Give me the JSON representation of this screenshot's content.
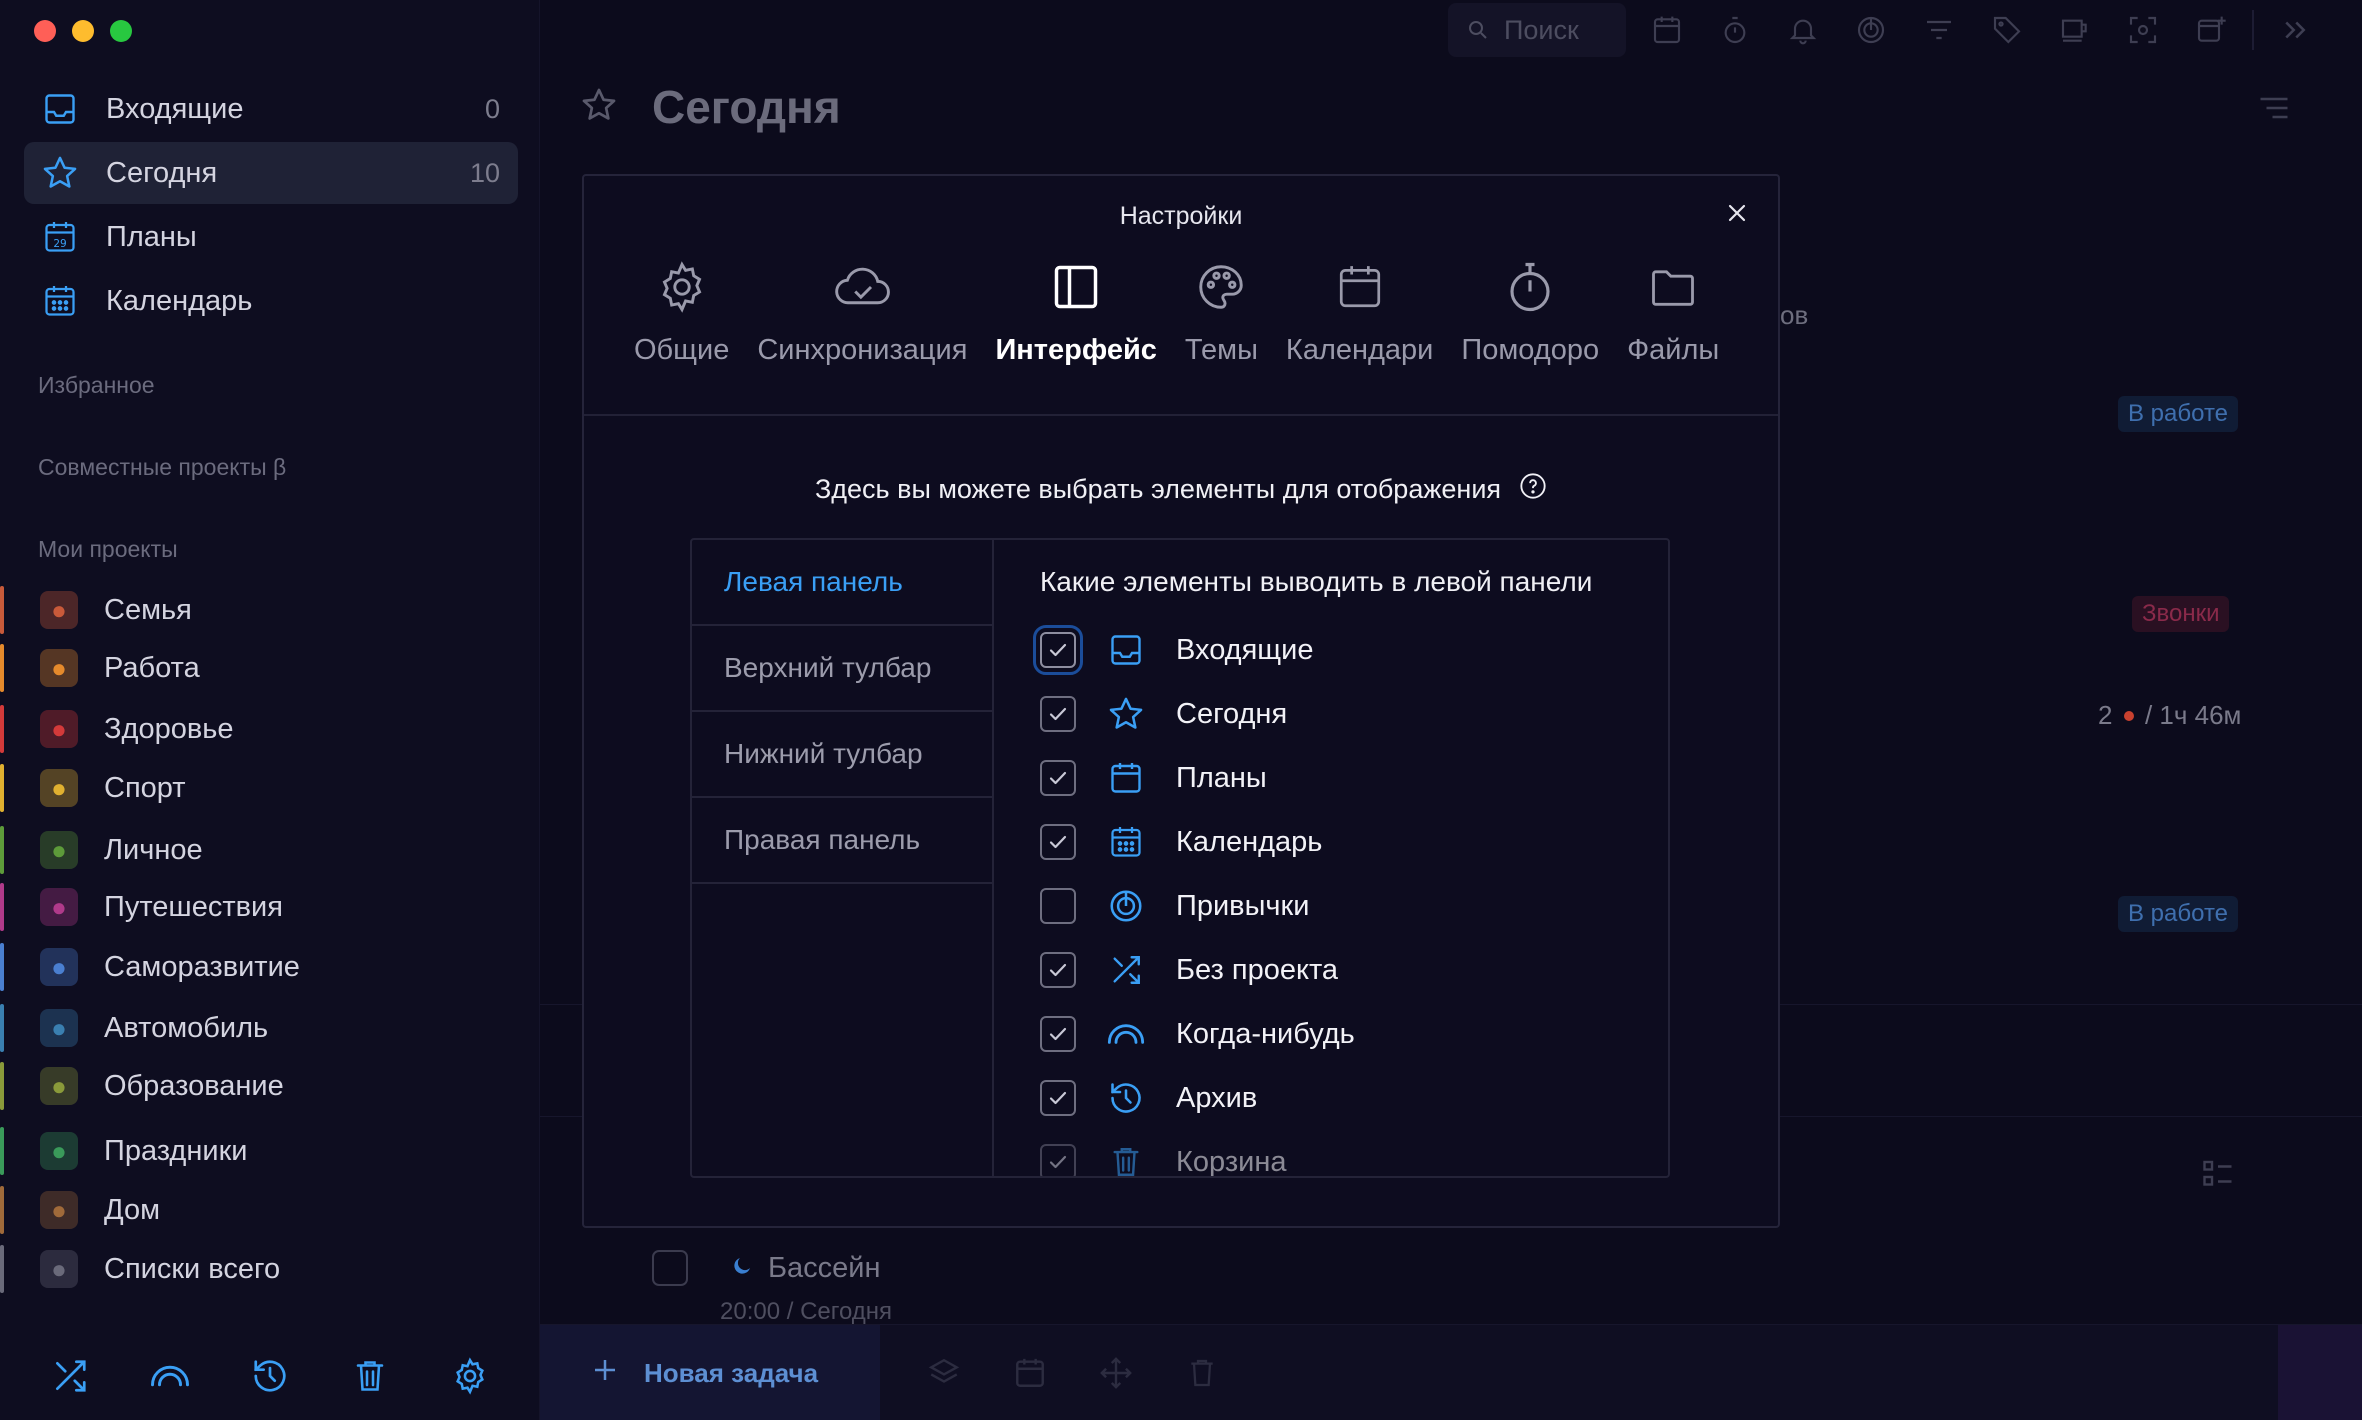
{
  "sidebar": {
    "nav": [
      {
        "label": "Входящие",
        "count": "0",
        "icon": "inbox-icon"
      },
      {
        "label": "Сегодня",
        "count": "10",
        "icon": "star-icon"
      },
      {
        "label": "Планы",
        "count": "",
        "icon": "calendar-29-icon"
      },
      {
        "label": "Календарь",
        "count": "",
        "icon": "calendar-grid-icon"
      }
    ],
    "favorites_header": "Избранное",
    "shared_header": "Совместные проекты β",
    "projects_header": "Мои проекты",
    "projects": [
      {
        "label": "Семья",
        "color": "#c85a3a",
        "emoji": "👪"
      },
      {
        "label": "Работа",
        "color": "#e58a2c",
        "emoji": "😎"
      },
      {
        "label": "Здоровье",
        "color": "#d33a3a",
        "emoji": "❤"
      },
      {
        "label": "Спорт",
        "color": "#e0b030",
        "emoji": "🥇"
      },
      {
        "label": "Личное",
        "color": "#5d9b3a",
        "emoji": "🐢"
      },
      {
        "label": "Путешествия",
        "color": "#b03a8a",
        "emoji": "✈"
      },
      {
        "label": "Саморазвитие",
        "color": "#4a7fd0",
        "emoji": "💫"
      },
      {
        "label": "Автомобиль",
        "color": "#3a7fb0",
        "emoji": "🚘"
      },
      {
        "label": "Образование",
        "color": "#8a9a3a",
        "emoji": "✌"
      },
      {
        "label": "Праздники",
        "color": "#3a9a5a",
        "emoji": "🎄"
      },
      {
        "label": "Дом",
        "color": "#a06a3a",
        "emoji": "🏠"
      },
      {
        "label": "Списки всего",
        "color": "#6a6a7a",
        "emoji": "📓"
      }
    ]
  },
  "topbar": {
    "search_placeholder": "Поиск"
  },
  "main": {
    "title": "Сегодня",
    "bg_fragment": "ов",
    "badge_work_1": "В работе",
    "badge_calls": "Звонки",
    "pomodoro_count": "2",
    "pomodoro_time": "/ 1ч 46м",
    "badge_work_2": "В работе",
    "task_name": "Бассейн",
    "task_sub": "20:00 / Сегодня",
    "new_task": "Новая задача"
  },
  "modal": {
    "title": "Настройки",
    "tabs": [
      {
        "label": "Общие",
        "icon": "gear-icon"
      },
      {
        "label": "Синхронизация",
        "icon": "cloud-sync-icon"
      },
      {
        "label": "Интерфейс",
        "icon": "layout-sidebar-icon"
      },
      {
        "label": "Темы",
        "icon": "palette-icon"
      },
      {
        "label": "Календари",
        "icon": "calendar-icon"
      },
      {
        "label": "Помодоро",
        "icon": "stopwatch-icon"
      },
      {
        "label": "Файлы",
        "icon": "folder-icon"
      }
    ],
    "active_tab": "Интерфейс",
    "subtitle": "Здесь вы можете выбрать элементы для отображения",
    "sections": [
      "Левая панель",
      "Верхний тулбар",
      "Нижний тулбар",
      "Правая панель"
    ],
    "active_section": "Левая панель",
    "right_header": "Какие элементы выводить в левой панели",
    "items": [
      {
        "label": "Входящие",
        "checked": true,
        "icon": "inbox-icon"
      },
      {
        "label": "Сегодня",
        "checked": true,
        "icon": "star-icon"
      },
      {
        "label": "Планы",
        "checked": true,
        "icon": "calendar-icon"
      },
      {
        "label": "Календарь",
        "checked": true,
        "icon": "calendar-grid-icon"
      },
      {
        "label": "Привычки",
        "checked": false,
        "icon": "habits-icon"
      },
      {
        "label": "Без проекта",
        "checked": true,
        "icon": "shuffle-icon"
      },
      {
        "label": "Когда-нибудь",
        "checked": true,
        "icon": "rainbow-icon"
      },
      {
        "label": "Архив",
        "checked": true,
        "icon": "history-icon"
      },
      {
        "label": "Корзина",
        "checked": true,
        "icon": "trash-icon"
      }
    ]
  },
  "colors": {
    "accent": "#3a9ff5",
    "bg": "#0b0a1c"
  }
}
